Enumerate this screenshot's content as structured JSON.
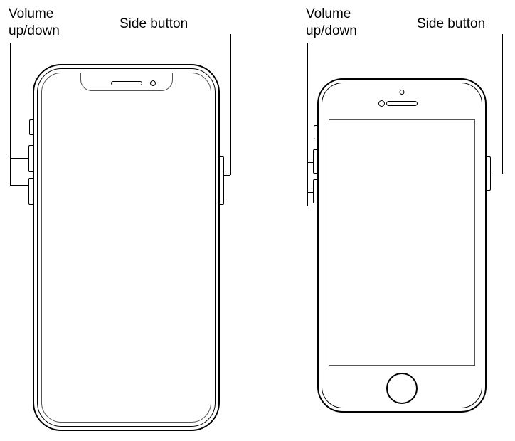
{
  "left": {
    "volume_label": "Volume\nup/down",
    "side_label": "Side button"
  },
  "right": {
    "volume_label": "Volume\nup/down",
    "side_label": "Side button"
  }
}
